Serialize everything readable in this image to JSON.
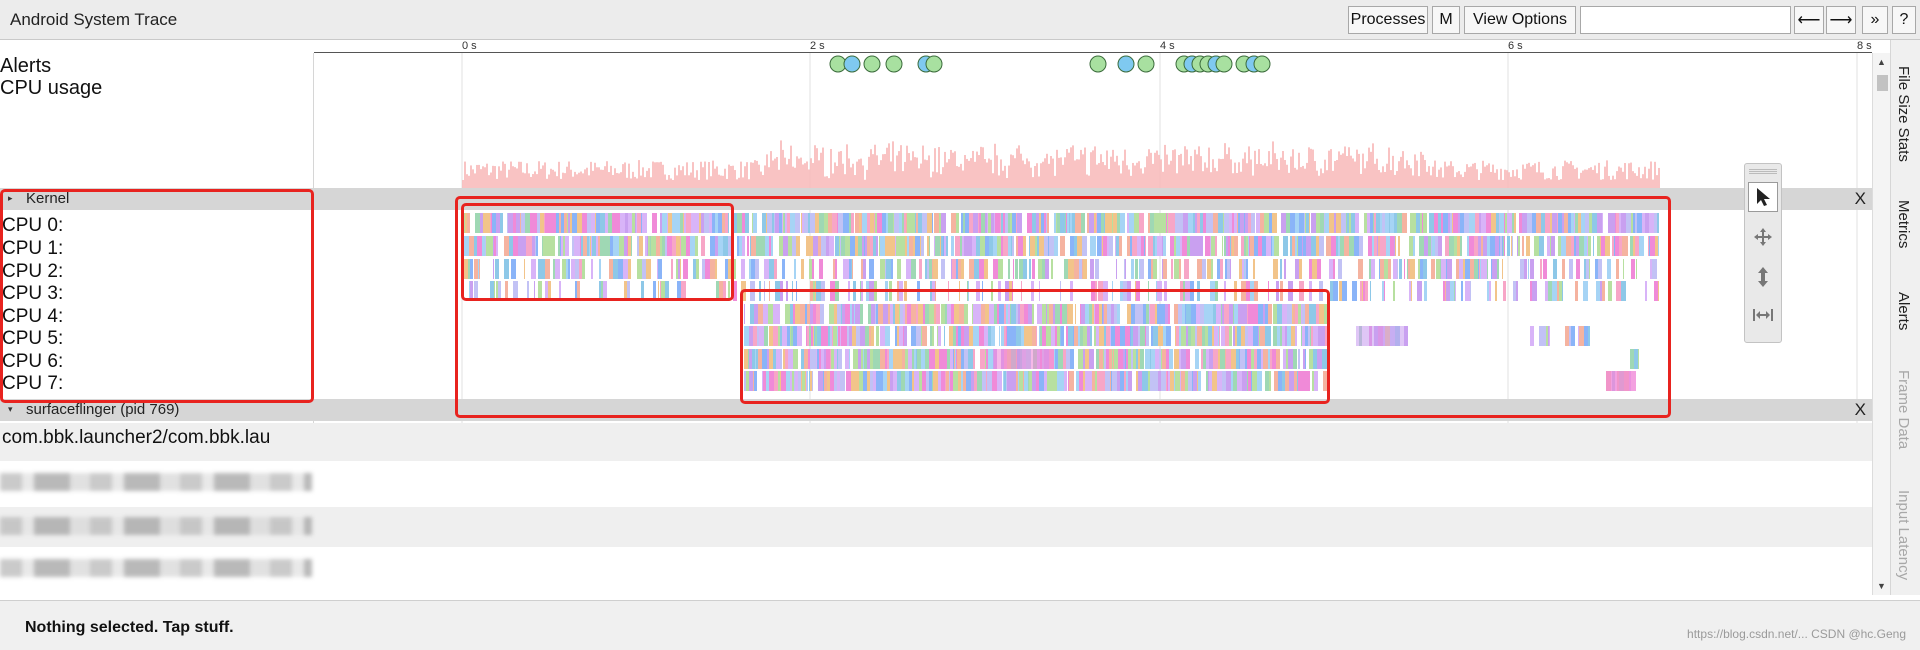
{
  "window": {
    "title": "Android System Trace"
  },
  "toolbar": {
    "processes_label": "Processes",
    "m_label": "M",
    "view_options_label": "View Options",
    "search_value": "",
    "back_icon": "left-arrow-icon",
    "back_glyph": "⟵",
    "forward_icon": "right-arrow-icon",
    "forward_glyph": "⟶",
    "more_glyph": "»",
    "help_label": "?"
  },
  "ruler": {
    "ticks": [
      "0 s",
      "2 s",
      "4 s",
      "6 s",
      "8 s"
    ]
  },
  "tracks": {
    "alerts_label": "Alerts",
    "cpu_usage_label": "CPU usage",
    "kernel": {
      "header": "Kernel",
      "close": "X"
    },
    "cpus": [
      "CPU 0:",
      "CPU 1:",
      "CPU 2:",
      "CPU 3:",
      "CPU 4:",
      "CPU 5:",
      "CPU 6:",
      "CPU 7:"
    ],
    "surfaceflinger": {
      "header": "surfaceflinger (pid 769)",
      "close": "X"
    },
    "process_rows": [
      "com.bbk.launcher2/com.bbk.lau"
    ]
  },
  "side_tabs": [
    "File Size Stats",
    "Metrics",
    "Alerts",
    "Frame Data",
    "Input Latency"
  ],
  "tools": [
    "pointer-icon",
    "pan-icon",
    "zoom-icon",
    "timing-icon"
  ],
  "status": {
    "message": "Nothing selected. Tap stuff."
  },
  "watermark": "https://blog.csdn.net/... CSDN @hc.Geng",
  "colors": {
    "highlight": "#e8231f",
    "alert_fill": "#a8e0a0",
    "alert_fill_blue": "#7fc9f0",
    "cpu_usage": "#f8b9b9",
    "kernel_header": "#d6d6d6"
  }
}
